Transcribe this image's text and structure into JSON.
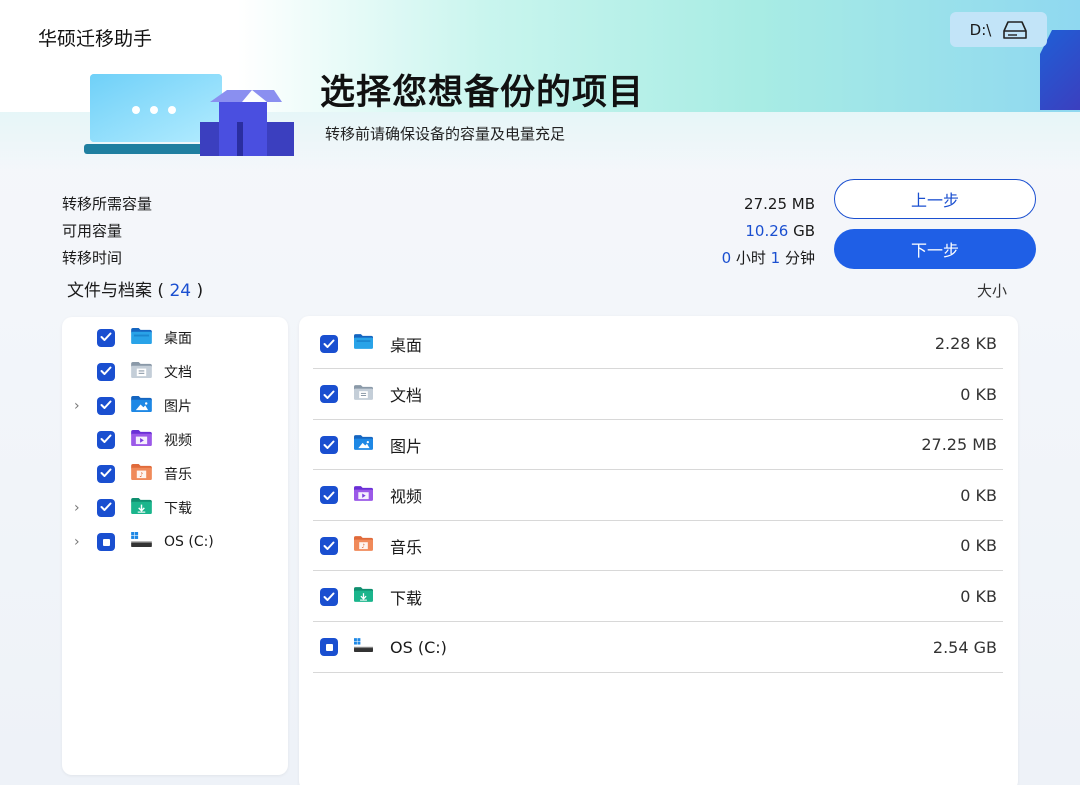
{
  "app": {
    "title": "华硕迁移助手"
  },
  "drive": {
    "label": "D:\\"
  },
  "header": {
    "title": "选择您想备份的项目",
    "subtitle": "转移前请确保设备的容量及电量充足"
  },
  "summary": {
    "required_label": "转移所需容量",
    "available_label": "可用容量",
    "time_label": "转移时间",
    "required_value": "27.25 MB",
    "available_value_num": "10.26",
    "available_value_unit": " GB",
    "time_hours": "0",
    "time_hours_unit": " 小时 ",
    "time_minutes": "1",
    "time_minutes_unit": " 分钟"
  },
  "buttons": {
    "prev": "上一步",
    "next": "下一步"
  },
  "section": {
    "title_prefix": "文件与档案 ( ",
    "count": "24",
    "title_suffix": " )",
    "size_header": "大小"
  },
  "tree": [
    {
      "label": "桌面",
      "icon": "desktop-folder-icon",
      "checked": "full",
      "expandable": false
    },
    {
      "label": "文档",
      "icon": "documents-folder-icon",
      "checked": "full",
      "expandable": false
    },
    {
      "label": "图片",
      "icon": "pictures-folder-icon",
      "checked": "full",
      "expandable": true
    },
    {
      "label": "视频",
      "icon": "videos-folder-icon",
      "checked": "full",
      "expandable": false
    },
    {
      "label": "音乐",
      "icon": "music-folder-icon",
      "checked": "full",
      "expandable": false
    },
    {
      "label": "下载",
      "icon": "downloads-folder-icon",
      "checked": "full",
      "expandable": true
    },
    {
      "label": "OS (C:)",
      "icon": "os-drive-icon",
      "checked": "partial",
      "expandable": true
    }
  ],
  "list": [
    {
      "name": "桌面",
      "size": "2.28 KB",
      "icon": "desktop-folder-icon",
      "checked": "full"
    },
    {
      "name": "文档",
      "size": "0 KB",
      "icon": "documents-folder-icon",
      "checked": "full"
    },
    {
      "name": "图片",
      "size": "27.25 MB",
      "icon": "pictures-folder-icon",
      "checked": "full"
    },
    {
      "name": "视频",
      "size": "0 KB",
      "icon": "videos-folder-icon",
      "checked": "full"
    },
    {
      "name": "音乐",
      "size": "0 KB",
      "icon": "music-folder-icon",
      "checked": "full"
    },
    {
      "name": "下载",
      "size": "0 KB",
      "icon": "downloads-folder-icon",
      "checked": "full"
    },
    {
      "name": "OS (C:)",
      "size": "2.54 GB",
      "icon": "os-drive-icon",
      "checked": "partial"
    }
  ],
  "colors": {
    "accent": "#1a4fd0",
    "primary_button": "#1f5fe6",
    "drive_button": "#c2e4f8"
  }
}
